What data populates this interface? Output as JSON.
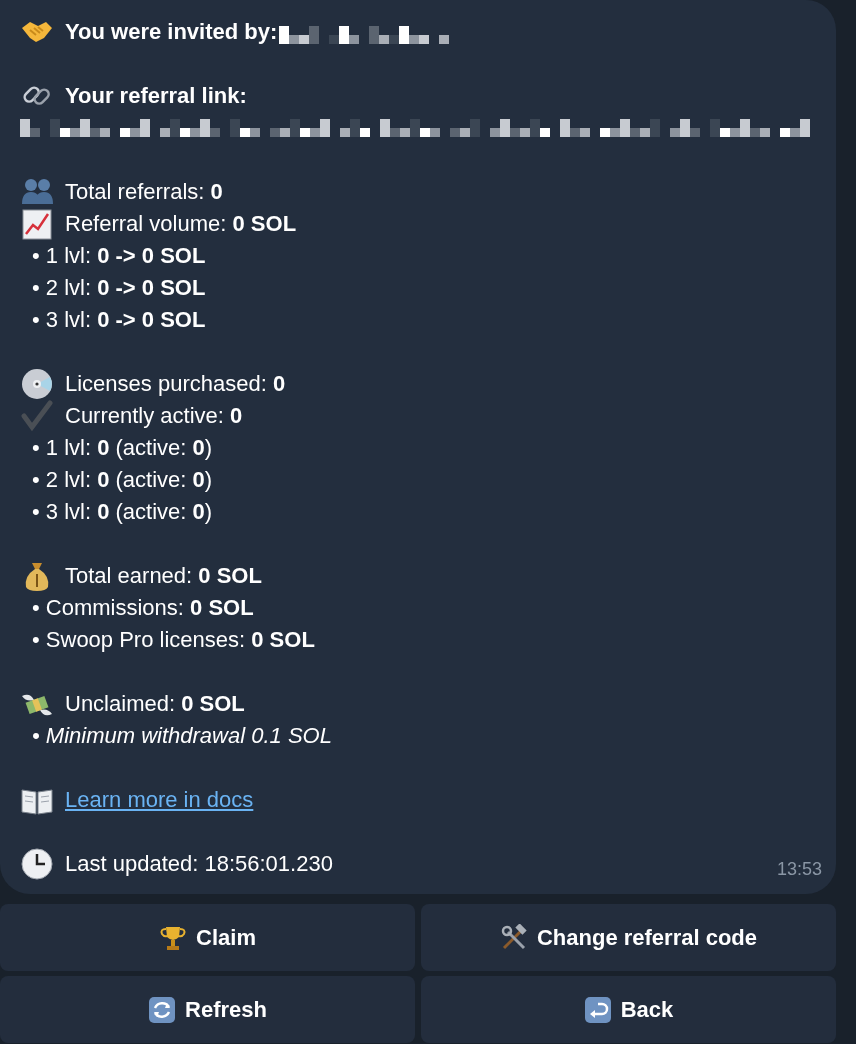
{
  "message": {
    "sections": [
      {
        "lines": [
          {
            "kind": "heading",
            "text": "You were invited by:",
            "redacted_value": true
          }
        ]
      },
      {
        "lines": [
          {
            "kind": "heading",
            "text": "Your referral link:"
          },
          {
            "kind": "redacted"
          }
        ]
      },
      {
        "lines": [
          {
            "kind": "icon",
            "text": "Total referrals: **0**"
          },
          {
            "kind": "icon",
            "text": "Referral volume: **0 SOL**"
          },
          {
            "kind": "bullet",
            "text": "• 1 lvl: **0 -> 0 SOL**"
          },
          {
            "kind": "bullet",
            "text": "• 2 lvl: **0 -> 0 SOL**"
          },
          {
            "kind": "bullet",
            "text": "• 3 lvl: **0 -> 0 SOL**"
          }
        ]
      },
      {
        "lines": [
          {
            "kind": "icon",
            "text": "Licenses purchased: **0**"
          },
          {
            "kind": "icon",
            "text": "Currently active: **0**"
          },
          {
            "kind": "bullet",
            "text": "• 1 lvl: **0** (active: **0**)"
          },
          {
            "kind": "bullet",
            "text": "• 2 lvl: **0** (active: **0**)"
          },
          {
            "kind": "bullet",
            "text": "• 3 lvl: **0** (active: **0**)"
          }
        ]
      },
      {
        "lines": [
          {
            "kind": "icon",
            "text": "Total earned: **0 SOL**"
          },
          {
            "kind": "bullet",
            "text": "• Commissions: **0 SOL**"
          },
          {
            "kind": "bullet",
            "text": "• Swoop Pro licenses: **0 SOL**"
          }
        ]
      },
      {
        "lines": [
          {
            "kind": "icon",
            "text": "Unclaimed: **0 SOL**"
          },
          {
            "kind": "italic-bullet",
            "text": "• Minimum withdrawal 0.1 SOL"
          }
        ]
      },
      {
        "lines": [
          {
            "kind": "link",
            "text": "Learn more in docs"
          }
        ]
      },
      {
        "lines": [
          {
            "kind": "icon",
            "text": "Last updated: 18:56:01.230"
          }
        ]
      }
    ],
    "time": "13:53"
  },
  "buttons": [
    [
      "Claim",
      "Change referral code"
    ],
    [
      "Refresh",
      "Back"
    ]
  ]
}
